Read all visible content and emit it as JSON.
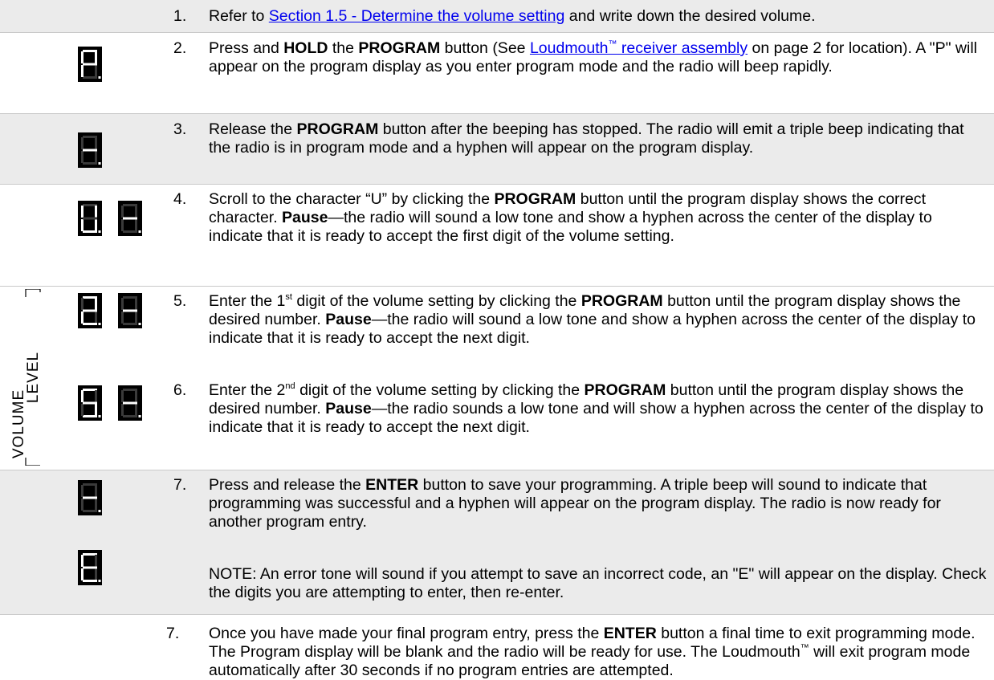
{
  "steps": [
    {
      "num": "1.",
      "pre": "Refer to ",
      "link": "Section 1.5 - Determine the volume setting",
      "post": " and write down the desired volume."
    },
    {
      "num": "2.",
      "t1": "Press and ",
      "b1": "HOLD",
      "t2": " the ",
      "b2": "PROGRAM",
      "t3": " button (See ",
      "link": "Loudmouth",
      "tm": "™",
      "link2": " receiver assembly",
      "t4": " on page 2 for location). A \"P\" will appear on the program display as you enter program mode and the radio will beep rapidly."
    },
    {
      "num": "3.",
      "t1": "Release the ",
      "b1": "PROGRAM",
      "t2": " button after the beeping has stopped. The radio will emit a triple beep indicating that the radio is in program mode and a hyphen will appear on the program display."
    },
    {
      "num": "4.",
      "t1": "Scroll to the character “U” by clicking the ",
      "b1": "PROGRAM",
      "t2": " button until the program display shows the correct character. ",
      "b2": "Pause",
      "t3": "—the radio will sound a low tone and show a hyphen across the center of the display to indicate that it is ready to accept the first digit of the volume setting."
    },
    {
      "num": "5.",
      "t1": "Enter the 1",
      "sup": "st",
      "t2": " digit of the volume setting by clicking the ",
      "b1": "PROGRAM",
      "t3": " button until the program display shows the desired number. ",
      "b2": "Pause",
      "t4": "—the radio will sound a low tone and show a hyphen across the center of the display to indicate that it is ready to accept the next digit."
    },
    {
      "num": "6.",
      "t1": "Enter the 2",
      "sup": "nd",
      "t2": " digit of the volume setting by clicking the ",
      "b1": "PROGRAM",
      "t3": " button until the program display shows the desired number. ",
      "b2": "Pause",
      "t4": "—the radio sounds a low tone and will show a hyphen across the center of the display to indicate that it is ready to accept the next digit."
    },
    {
      "num": "7.",
      "t1": "Press and release the ",
      "b1": "ENTER",
      "t2": " button to save your programming. A triple beep will sound to indicate that programming was successful and a hyphen will appear on the program display.  The radio is now ready for another program entry."
    },
    {
      "num": "7.",
      "t1": "Once you have made your final program entry, press the ",
      "b1": "ENTER",
      "t2": " button a final time to exit programming mode.  The Program display will be blank and the radio will be ready for use. The Loudmouth",
      "tm": "™",
      "t3": " will exit program mode automatically after 30 seconds if no program entries are attempted."
    }
  ],
  "note": "NOTE:  An error tone will sound if you attempt to save an incorrect code, an \"E\" will appear on the display.  Check the digits you are attempting to enter, then re-enter.",
  "volume_label": {
    "line1": "VOLUME",
    "line2": "LEVEL"
  },
  "displays": {
    "step2": [
      "P"
    ],
    "step3": [
      "-"
    ],
    "step4": [
      "U",
      "-"
    ],
    "step5": [
      "2",
      "-"
    ],
    "step6": [
      "5",
      "-"
    ],
    "step7": [
      "-"
    ],
    "note": [
      "E"
    ]
  },
  "colors": {
    "band": "#ebebeb",
    "segment_on": "#ffffff",
    "segment_off": "#3a3a3a",
    "link": "#0000ee"
  }
}
